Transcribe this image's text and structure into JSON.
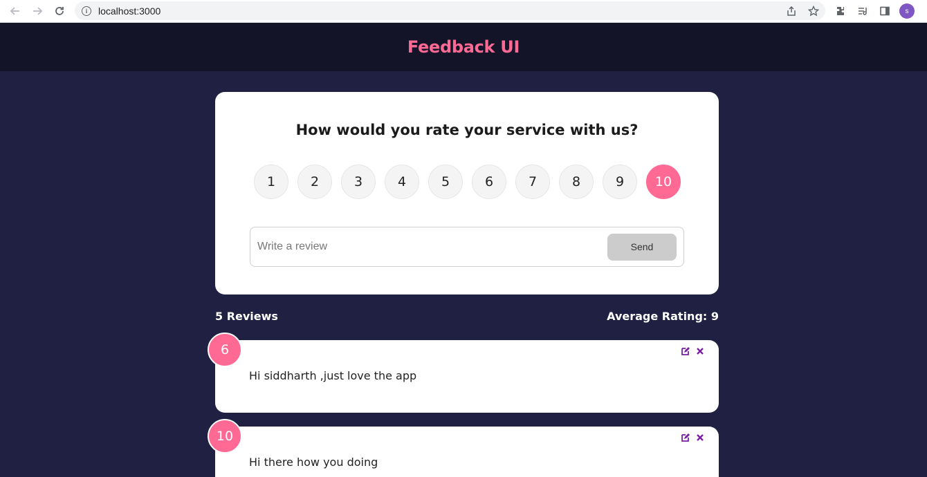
{
  "browser": {
    "url": "localhost:3000",
    "profile_initial": "s"
  },
  "header": {
    "title": "Feedback UI"
  },
  "rating_card": {
    "question": "How would you rate your service with us?",
    "options": [
      "1",
      "2",
      "3",
      "4",
      "5",
      "6",
      "7",
      "8",
      "9",
      "10"
    ],
    "selected": "10",
    "review_placeholder": "Write a review",
    "send_label": "Send"
  },
  "stats": {
    "count_label": "5 Reviews",
    "average_label": "Average Rating: 9"
  },
  "feedback": [
    {
      "rating": "6",
      "text": "Hi siddharth ,just love the app"
    },
    {
      "rating": "10",
      "text": "Hi there how you doing"
    }
  ],
  "colors": {
    "accent": "#ff6a95",
    "background": "#202142",
    "header_bg": "#141429",
    "action_icon": "#7a1fa2"
  }
}
